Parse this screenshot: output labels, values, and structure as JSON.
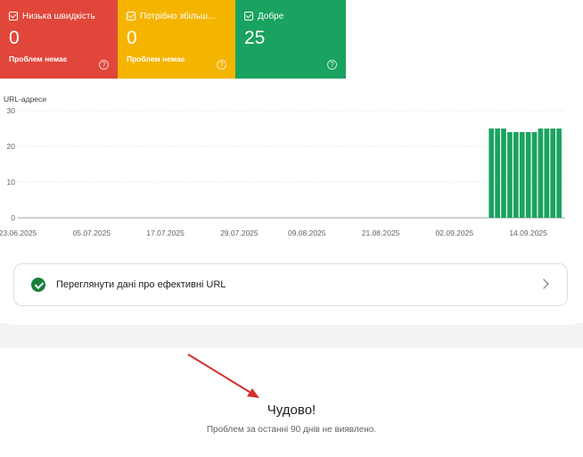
{
  "tiles": [
    {
      "title": "Низька швидкість",
      "count": "0",
      "sub": "Проблем немає",
      "color": "#e0463a",
      "help": "?"
    },
    {
      "title": "Потрібно збільш...",
      "count": "0",
      "sub": "Проблем немає",
      "color": "#f5b400",
      "help": "?"
    },
    {
      "title": "Добре",
      "count": "25",
      "sub": "",
      "color": "#1aa260",
      "help": "?"
    }
  ],
  "chart_data": {
    "type": "bar",
    "ylabel": "URL-адреси",
    "ylim": [
      0,
      30
    ],
    "yticks": [
      "0",
      "10",
      "20",
      "30"
    ],
    "xticks": [
      "23.06.2025",
      "05.07.2025",
      "17.07.2025",
      "29.07.2025",
      "09.08.2025",
      "21.08.2025",
      "02.09.2025",
      "14.09.2025"
    ],
    "x_start": "2025-06-23",
    "x_end": "2025-09-20",
    "series": [
      {
        "color": "#1aa260",
        "x": [
          "2025-09-08",
          "2025-09-09",
          "2025-09-10",
          "2025-09-11",
          "2025-09-12",
          "2025-09-13",
          "2025-09-14",
          "2025-09-15",
          "2025-09-16",
          "2025-09-17",
          "2025-09-18",
          "2025-09-19"
        ],
        "values": [
          25,
          25,
          25,
          24,
          24,
          24,
          24,
          24,
          25,
          25,
          25,
          25
        ]
      }
    ],
    "grid": true
  },
  "card": {
    "label": "Переглянути дані про ефективні URL"
  },
  "result": {
    "title": "Чудово!",
    "note": "Проблем за останні 90 днів не виявлено."
  },
  "colors": {
    "accent": "#188038",
    "arrow": "#d32f2f",
    "band": "#f1f3f4"
  }
}
